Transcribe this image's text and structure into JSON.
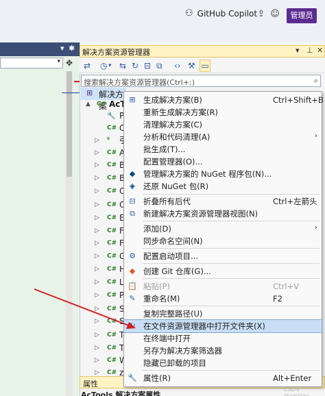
{
  "titlebar": {
    "copilot_label": "GitHub Copilot",
    "admin_label": "管理员"
  },
  "solution_explorer": {
    "title": "解决方案资源管理器",
    "search_placeholder": "搜索解决方案资源管理器(Ctrl+;)",
    "solution_row": "解决方案",
    "project_name": "AcTo",
    "tree_letters": [
      "P",
      "C",
      "引",
      "A",
      "B",
      "B",
      "C",
      "C",
      "E",
      "F",
      "F",
      "G",
      "H",
      "L",
      "P",
      "S",
      "S",
      "T",
      "T",
      "W",
      "z"
    ]
  },
  "properties": {
    "title": "属性",
    "row": "AcTools 解决方案属性"
  },
  "context_menu": {
    "items": [
      {
        "label": "生成解决方案(B)",
        "shortcut": "Ctrl+Shift+B",
        "icon": "build-icon"
      },
      {
        "label": "重新生成解决方案(R)",
        "shortcut": "",
        "icon": ""
      },
      {
        "label": "清理解决方案(C)",
        "shortcut": "",
        "icon": ""
      },
      {
        "label": "分析和代码清理(A)",
        "shortcut": "",
        "icon": "",
        "submenu": true
      },
      {
        "label": "批生成(T)...",
        "shortcut": "",
        "icon": ""
      },
      {
        "label": "配置管理器(O)...",
        "shortcut": "",
        "icon": ""
      },
      {
        "label": "管理解决方案的 NuGet 程序包(N)...",
        "shortcut": "",
        "icon": "nuget-icon"
      },
      {
        "label": "还原 NuGet 包(R)",
        "shortcut": "",
        "icon": "nuget-restore-icon"
      },
      {
        "label": "折叠所有后代",
        "shortcut": "Ctrl+左箭头",
        "icon": "collapse-icon"
      },
      {
        "label": "新建解决方案资源管理器视图(N)",
        "shortcut": "",
        "icon": "new-view-icon"
      },
      {
        "label": "添加(D)",
        "shortcut": "",
        "icon": "",
        "submenu": true
      },
      {
        "label": "同步命名空间(N)",
        "shortcut": "",
        "icon": ""
      },
      {
        "label": "配置启动项目...",
        "shortcut": "",
        "icon": "gear-icon"
      },
      {
        "label": "创建 Git 仓库(G)...",
        "shortcut": "",
        "icon": "git-icon"
      },
      {
        "label": "粘贴(P)",
        "shortcut": "Ctrl+V",
        "icon": "paste-icon",
        "disabled": true
      },
      {
        "label": "重命名(M)",
        "shortcut": "F2",
        "icon": "rename-icon"
      },
      {
        "label": "复制完整路径(U)",
        "shortcut": "",
        "icon": ""
      },
      {
        "label": "在文件资源管理器中打开文件夹(X)",
        "shortcut": "",
        "icon": "open-folder-icon",
        "highlighted": true
      },
      {
        "label": "在终端中打开",
        "shortcut": "",
        "icon": ""
      },
      {
        "label": "另存为解决方案筛选器",
        "shortcut": "",
        "icon": ""
      },
      {
        "label": "隐藏已卸载的项目",
        "shortcut": "",
        "icon": ""
      },
      {
        "label": "属性(R)",
        "shortcut": "Alt+Enter",
        "icon": "wrench-icon"
      }
    ]
  },
  "watermark": "CSDN @yaojiaq",
  "colors": {
    "accent": "#5c2d91",
    "highlight": "#c9def5",
    "arrow": "#d12020"
  }
}
